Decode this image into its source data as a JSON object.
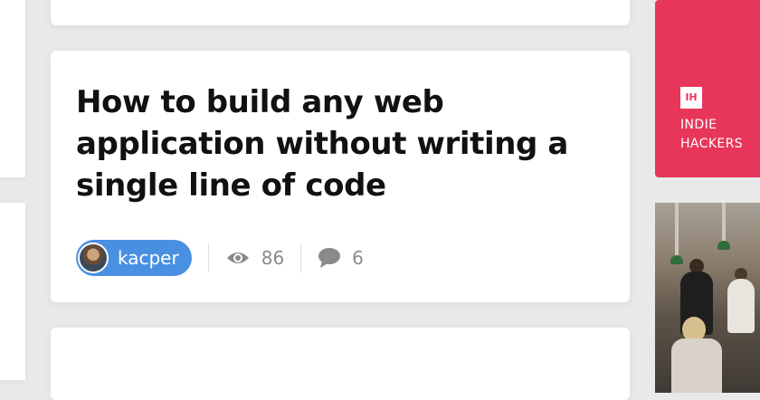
{
  "post": {
    "title": "How to build any web application without writing a single line of code",
    "author": "kacper",
    "views": "86",
    "comments": "6"
  },
  "sidebar": {
    "brand_logo": "IH",
    "brand_line1": "INDIE",
    "brand_line2": "HACKERS",
    "brand_color": "#e8365b"
  },
  "colors": {
    "author_pill": "#4a90e2",
    "title": "#111111",
    "meta": "#8a8a8a",
    "background": "#e9e9e9"
  },
  "icons": {
    "views": "eye-icon",
    "comments": "comment-bubble-icon"
  }
}
